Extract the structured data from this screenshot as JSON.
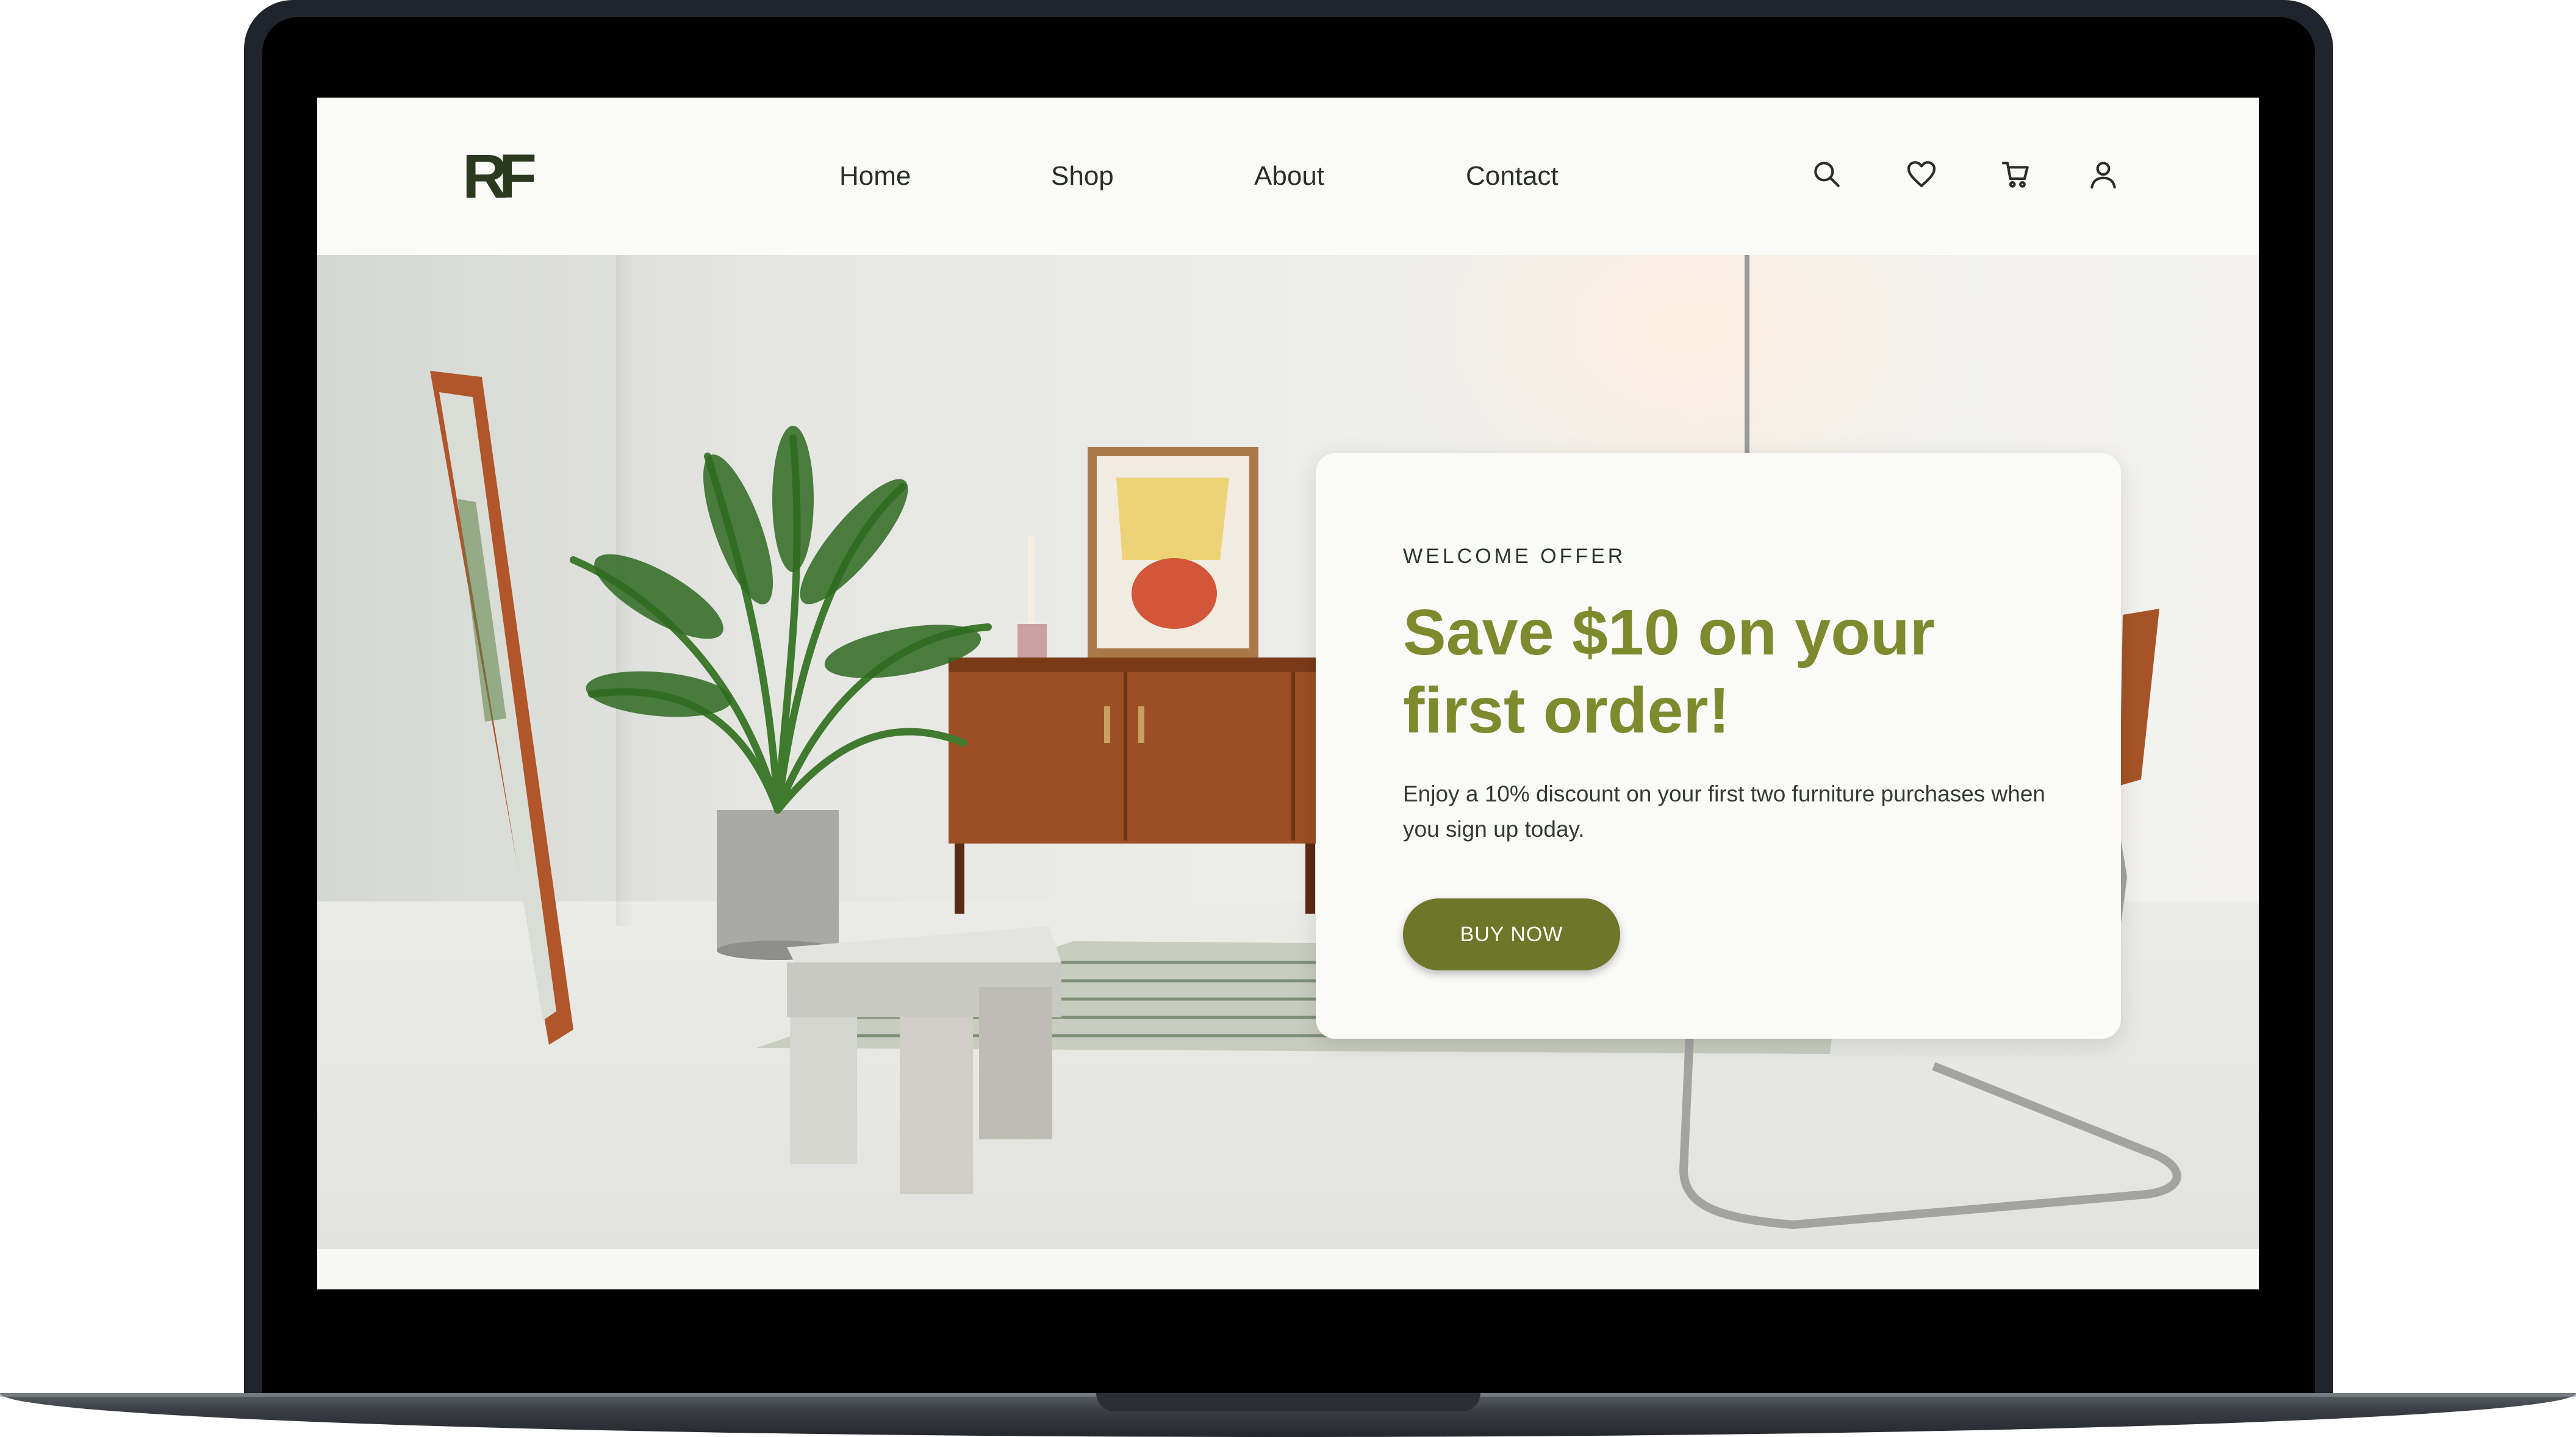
{
  "brand": {
    "logo_text": "RF"
  },
  "nav": {
    "links": [
      "Home",
      "Shop",
      "About",
      "Contact"
    ],
    "icons": [
      "search-icon",
      "heart-icon",
      "cart-icon",
      "user-icon"
    ]
  },
  "hero": {
    "offer": {
      "eyebrow": "WELCOME OFFER",
      "title": "Save $10 on your first order!",
      "description": "Enjoy a 10% discount on your first two furniture purchases when you sign up today.",
      "button_label": "BUY NOW"
    }
  },
  "colors": {
    "accent": "#7d8a2d",
    "button": "#6e762a",
    "logo": "#2b3a1f"
  }
}
